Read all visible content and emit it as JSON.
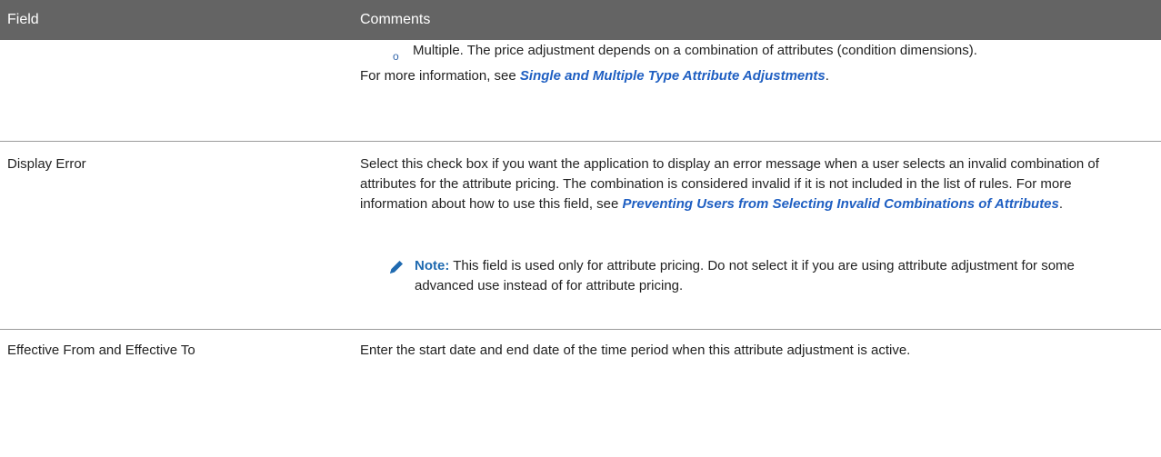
{
  "header": {
    "col_field": "Field",
    "col_comments": "Comments"
  },
  "row1": {
    "bullet_marker": "o",
    "bullet_text": "Multiple. The price adjustment depends on a combination of attributes (condition dimensions).",
    "more_info_prefix": "For more information, see ",
    "more_info_link": "Single and Multiple Type Attribute Adjustments",
    "more_info_suffix": "."
  },
  "row2": {
    "field": "Display Error",
    "comment_text": "Select this check box if you want the application to display an error message when a user selects an invalid combination of attributes for the attribute pricing. The combination is considered invalid if it is not included in the list of rules. For more information about how to use this field, see ",
    "comment_link": "Preventing Users from Selecting Invalid Combinations of Attributes",
    "comment_suffix": ".",
    "note_label": "Note:",
    "note_text": " This field is used only for attribute pricing. Do not select it if you are using attribute adjustment for some advanced use instead of for attribute pricing.",
    "note_icon": "pencil-icon"
  },
  "row3": {
    "field": "Effective From and Effective To",
    "comment": "Enter the start date and end date of the time period when this attribute adjustment is active."
  },
  "colors": {
    "header_bg": "#646464",
    "link": "#1f5fc2",
    "note_label": "#1f6ab0"
  }
}
